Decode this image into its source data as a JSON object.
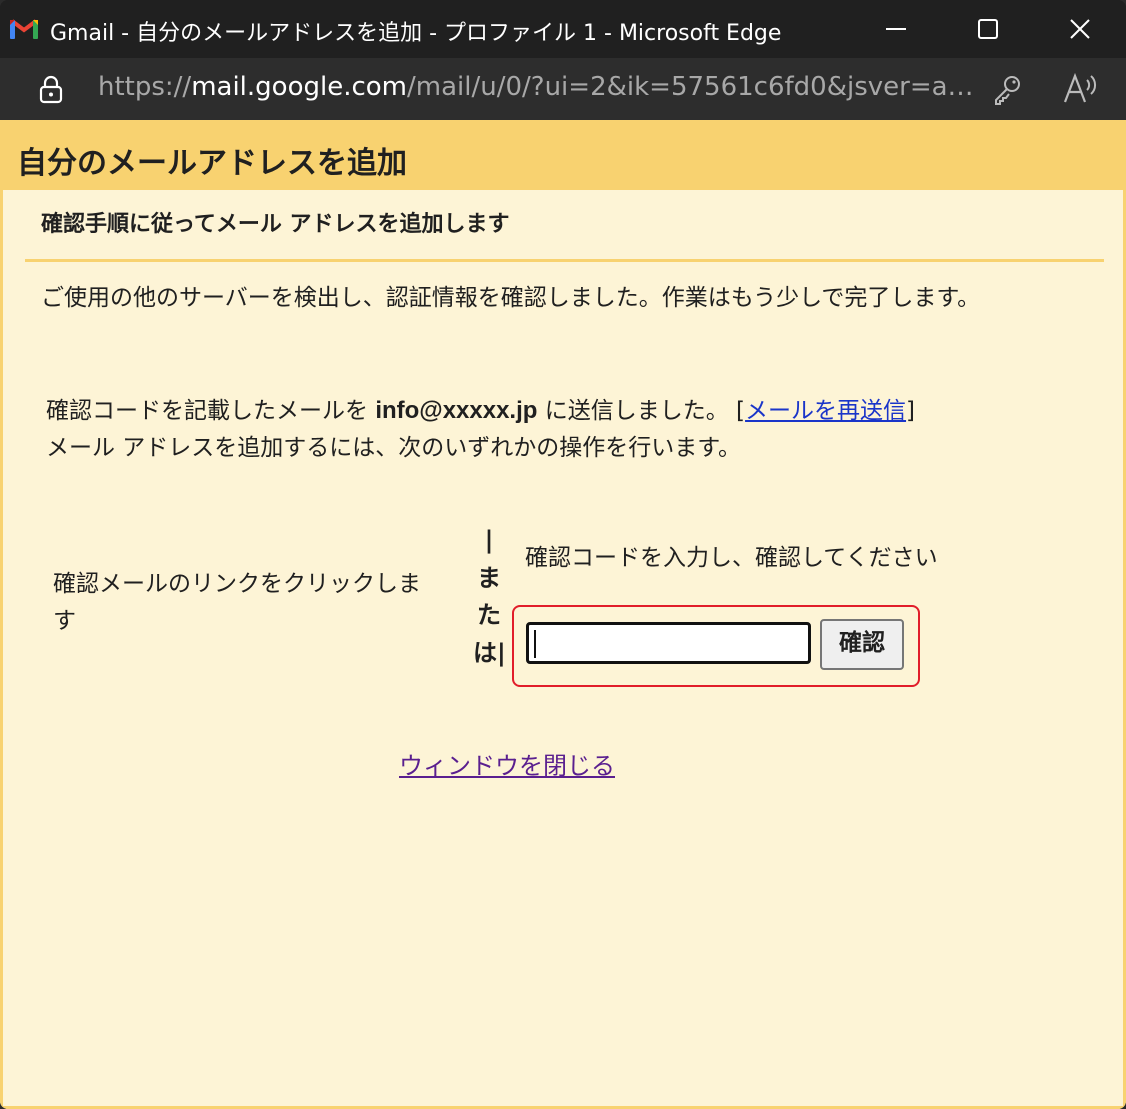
{
  "browser": {
    "window_title": "Gmail - 自分のメールアドレスを追加 - プロファイル 1 - Microsoft Edge",
    "url_prefix": "https://",
    "url_host": "mail.google.com",
    "url_rest": "/mail/u/0/?ui=2&ik=57561c6fd0&jsver=as44...",
    "icons": [
      "gmail-icon",
      "minimize-icon",
      "maximize-icon",
      "close-icon",
      "lock-icon",
      "key-icon",
      "read-aloud-icon"
    ]
  },
  "dialog": {
    "title": "自分のメールアドレスを追加",
    "subtitle": "確認手順に従ってメール アドレスを追加します",
    "intro": "ご使用の他のサーバーを検出し、認証情報を確認しました。作業はもう少しで完了します。",
    "sent_prefix": "確認コードを記載したメールを ",
    "email": "info@xxxxx.jp",
    "sent_suffix": " に送信しました。 [",
    "resend_link": "メールを再送信",
    "sent_close": "]",
    "instruction": "メール アドレスを追加するには、次のいずれかの操作を行います。",
    "option_link": "確認メールのリンクをクリックします",
    "or_text": "|または|",
    "option_code": "確認コードを入力し、確認してください",
    "code_value": "",
    "confirm_button": "確認",
    "close_window": "ウィンドウを閉じる"
  },
  "colors": {
    "header": "#f8d270",
    "background": "#fdf4d6",
    "highlight": "#e11d2a",
    "link": "#1a35c9",
    "visited_link": "#5a1f8f"
  }
}
